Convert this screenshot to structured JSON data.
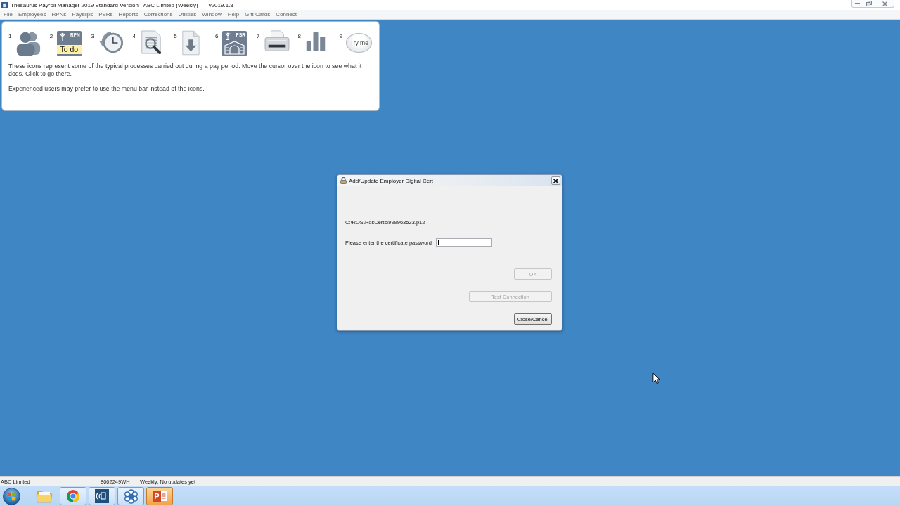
{
  "window": {
    "title": "Thesaurus Payroll Manager 2019 Standard Version - ABC Limited (Weekly)",
    "version": "v2019.1.8"
  },
  "menu_bar": [
    "File",
    "Employees",
    "RPNs",
    "Payslips",
    "PSRs",
    "Reports",
    "Corrections",
    "Utilities",
    "Window",
    "Help",
    "Gift Cards",
    "Connect"
  ],
  "icon_panel": {
    "shortcuts": [
      {
        "number": "1",
        "kind": "people"
      },
      {
        "number": "2",
        "kind": "rpn",
        "badge": "RPN",
        "caption": "To do"
      },
      {
        "number": "3",
        "kind": "clock"
      },
      {
        "number": "4",
        "kind": "search"
      },
      {
        "number": "5",
        "kind": "download"
      },
      {
        "number": "6",
        "kind": "psr",
        "badge": "PSR"
      },
      {
        "number": "7",
        "kind": "printer"
      },
      {
        "number": "8",
        "kind": "chart"
      },
      {
        "number": "9",
        "kind": "cloud",
        "caption": "Try me"
      }
    ],
    "description": "These icons represent some of the typical processes carried out during a pay period. Move the cursor over the icon to see what it does. Click to go there.",
    "hint": "Experienced users may prefer to use the menu bar instead of the icons."
  },
  "dialog": {
    "title": "Add/Update Employer Digital Cert",
    "file_path": "C:\\ROS\\RosCerts\\999963533.p12",
    "password_label": "Please enter the certificate password",
    "password_field": {
      "focused": true
    },
    "buttons": [
      {
        "label": "OK",
        "disabled": true
      },
      {
        "label": "Test Connection",
        "disabled": true
      },
      {
        "label": "Close/Cancel",
        "disabled": false
      }
    ]
  },
  "status_bar": [
    "ABC Limited",
    "8002249WH",
    "Weekly: No updates yet"
  ],
  "taskbar": {
    "apps": [
      {
        "kind": "folder",
        "open": false,
        "selected": false
      },
      {
        "kind": "circle",
        "open": true,
        "selected": false
      },
      {
        "kind": "document",
        "open": true,
        "selected": false
      },
      {
        "kind": "flower",
        "open": true,
        "selected": false
      },
      {
        "kind": "presentation",
        "label": "P",
        "open": true,
        "selected": true
      }
    ]
  }
}
